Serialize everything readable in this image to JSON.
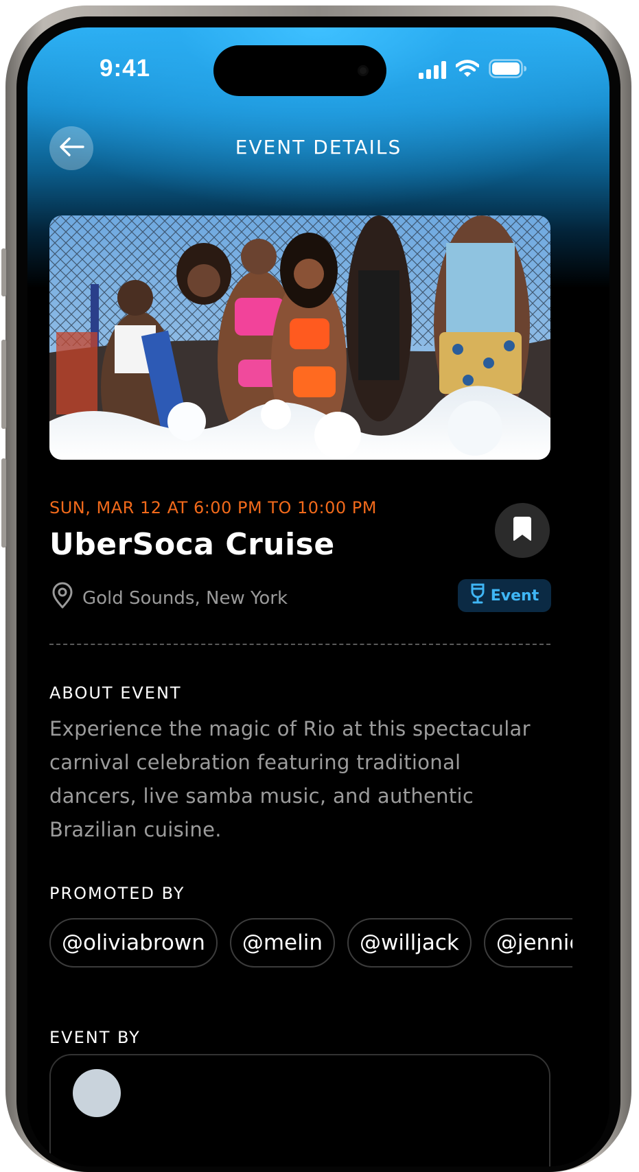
{
  "status_bar": {
    "time": "9:41"
  },
  "header": {
    "title": "EVENT DETAILS"
  },
  "event": {
    "date_time": "SUN, MAR 12 AT 6:00 PM TO 10:00 PM",
    "title": "UberSoca Cruise",
    "location": "Gold Sounds, New York",
    "category_tag": "Event"
  },
  "about": {
    "heading": "ABOUT EVENT",
    "text": "Experience the magic of Rio at this spectacular carnival celebration featuring traditional dancers, live samba music, and authentic Brazilian cuisine."
  },
  "promoted": {
    "heading": "PROMOTED BY",
    "promoters": [
      "@oliviabrown",
      "@melin",
      "@willjack",
      "@jenniec"
    ]
  },
  "event_by": {
    "heading": "EVENT BY"
  },
  "colors": {
    "accent_orange": "#f26a1b",
    "accent_blue": "#3fb6f5",
    "tag_bg": "#0b2a44",
    "background": "#000000"
  },
  "icons": {
    "back": "arrow-left-icon",
    "bookmark": "bookmark-icon",
    "location": "map-pin-icon",
    "category": "wine-glass-icon",
    "signal": "cellular-signal-icon",
    "wifi": "wifi-icon",
    "battery": "battery-icon"
  }
}
